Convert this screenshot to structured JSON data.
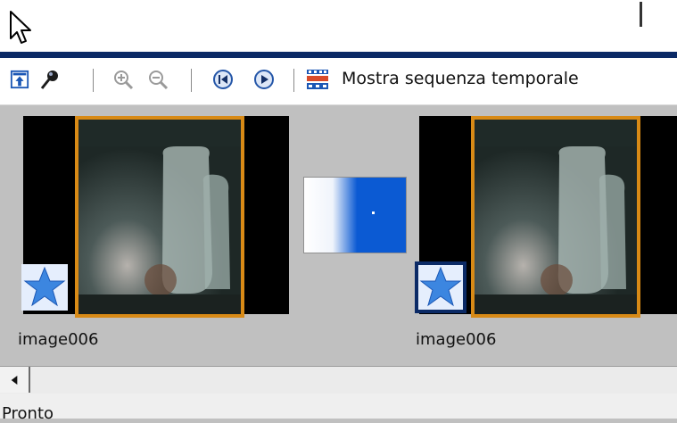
{
  "toolbar": {
    "storyboard_toggle_icon": "storyboard-up-icon",
    "pin_icon": "pin-icon",
    "zoom_in_icon": "zoom-in-icon",
    "zoom_out_icon": "zoom-out-icon",
    "rewind_icon": "rewind-icon",
    "play_icon": "play-icon",
    "timeline_icon": "timeline-icon",
    "show_timeline_label": "Mostra sequenza temporale"
  },
  "storyboard": {
    "clips": [
      {
        "label": "image006",
        "effect_icon": "star-effect-icon",
        "selected_effect": false
      },
      {
        "label": "image006",
        "effect_icon": "star-effect-icon",
        "selected_effect": true
      }
    ],
    "transition_icon": "fade-transition-icon"
  },
  "scrollbar": {
    "left_arrow_icon": "scroll-left-arrow-icon"
  },
  "status": {
    "text": "Pronto"
  },
  "colors": {
    "accent": "#0b2a66",
    "clip_border": "#d88a16",
    "transition_blue": "#0b5ad3"
  }
}
